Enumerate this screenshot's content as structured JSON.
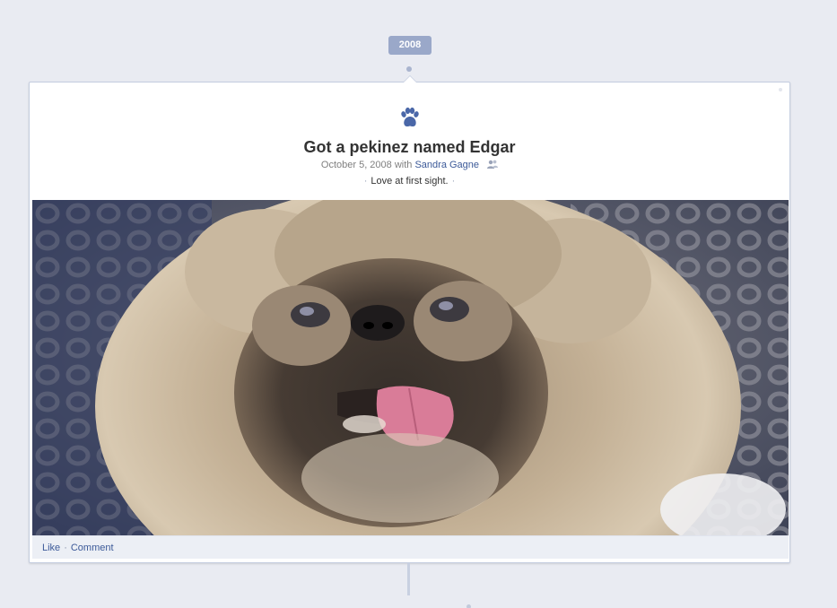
{
  "timeline": {
    "year": "2008"
  },
  "story": {
    "icon": "paw-icon",
    "title": "Got a pekinez named Edgar",
    "date": "October 5, 2008",
    "with_word": "with",
    "friend": "Sandra Gagne",
    "audience_icon": "friends-icon",
    "caption": "Love at first sight.",
    "accent_color": "#3b5998",
    "photo_subject": "pekingese-dog-photo"
  },
  "actions": {
    "like_label": "Like",
    "separator": "·",
    "comment_label": "Comment"
  }
}
